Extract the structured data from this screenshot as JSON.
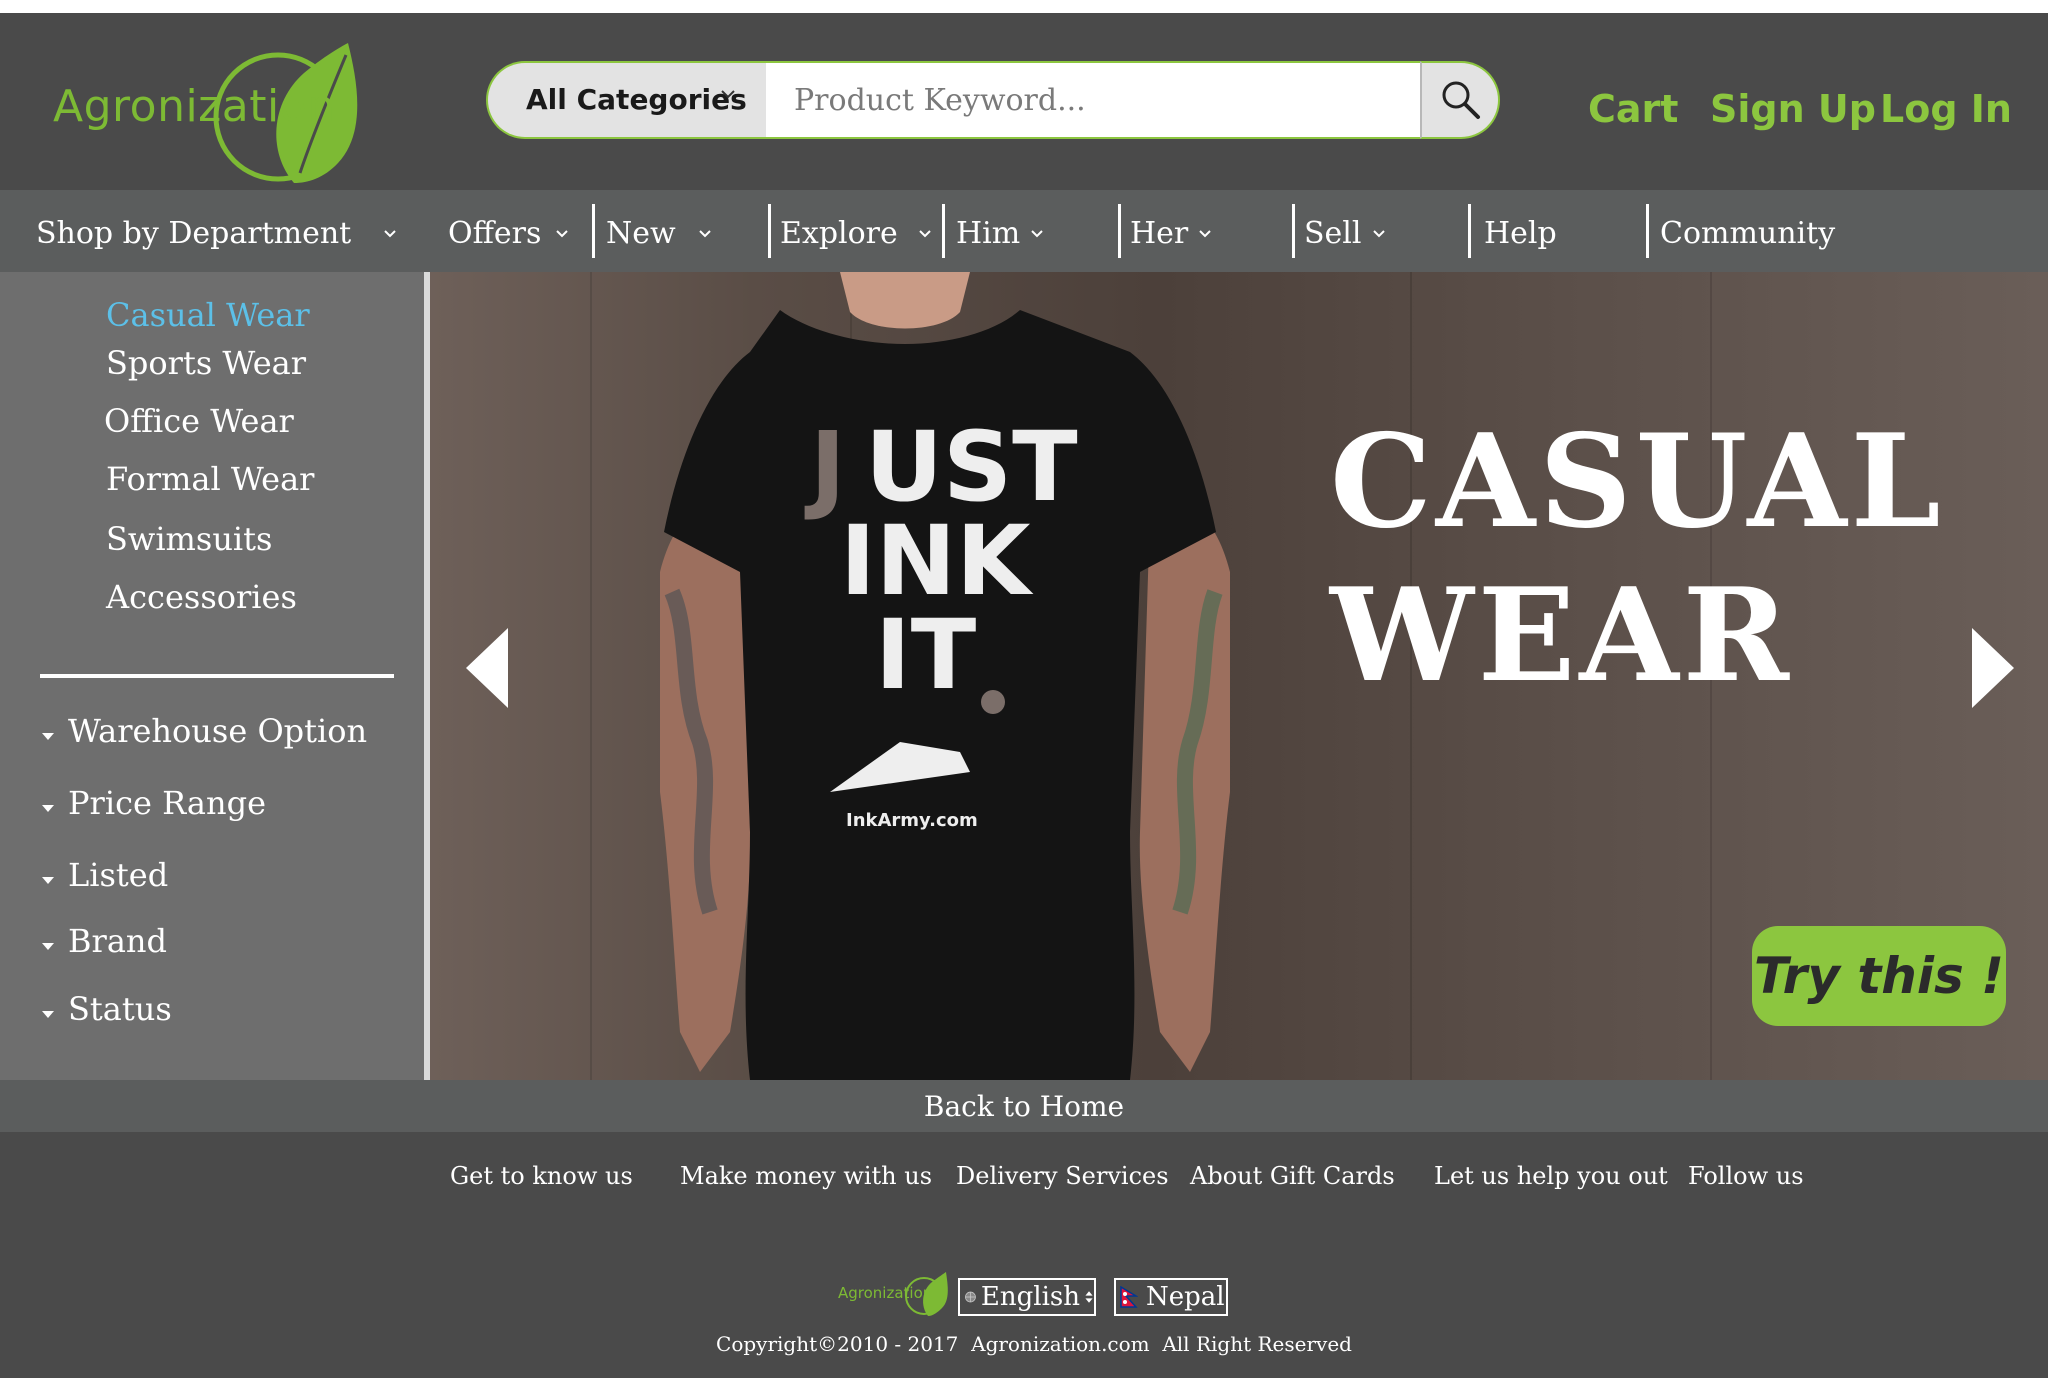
{
  "brand": {
    "name": "Agronization",
    "accent_color": "#8cc63f"
  },
  "search": {
    "category_label": "All Categories",
    "placeholder": "Product Keyword...",
    "value": "",
    "button_icon": "search-icon"
  },
  "header_links": {
    "cart": "Cart",
    "sign_up": "Sign Up",
    "log_in": "Log In"
  },
  "nav": {
    "items": [
      {
        "label": "Shop by Department",
        "has_dropdown": true
      },
      {
        "label": "Offers",
        "has_dropdown": true
      },
      {
        "label": "New",
        "has_dropdown": true
      },
      {
        "label": "Explore",
        "has_dropdown": true
      },
      {
        "label": "Him",
        "has_dropdown": true
      },
      {
        "label": "Her",
        "has_dropdown": true
      },
      {
        "label": "Sell",
        "has_dropdown": true
      },
      {
        "label": "Help",
        "has_dropdown": false
      },
      {
        "label": "Community",
        "has_dropdown": false
      }
    ]
  },
  "sidebar": {
    "categories": [
      {
        "label": "Casual Wear",
        "active": true
      },
      {
        "label": "Sports Wear",
        "active": false
      },
      {
        "label": "Office Wear",
        "active": false
      },
      {
        "label": "Formal Wear",
        "active": false
      },
      {
        "label": "Swimsuits",
        "active": false
      },
      {
        "label": "Accessories",
        "active": false
      }
    ],
    "filters": [
      "Warehouse Option",
      "Price Range",
      "Listed",
      "Brand",
      "Status"
    ],
    "active_color": "#5cc0e8"
  },
  "banner": {
    "title_line1": "CASUAL",
    "title_line2": "WEAR",
    "cta": "Try this !",
    "shirt_text_line1": "JUST",
    "shirt_text_line2": "INK",
    "shirt_text_line3": "IT.",
    "shirt_brand": "InkArmy.com"
  },
  "back_to_home": "Back to Home",
  "footer": {
    "links": [
      "Get to know us",
      "Make money with us",
      "Delivery Services",
      "About Gift Cards",
      "Let us help you out",
      "Follow us"
    ],
    "language": "English",
    "country": "Nepal",
    "copyright": "Copyright©2010 - 2017  Agronization.com  All Right Reserved"
  }
}
